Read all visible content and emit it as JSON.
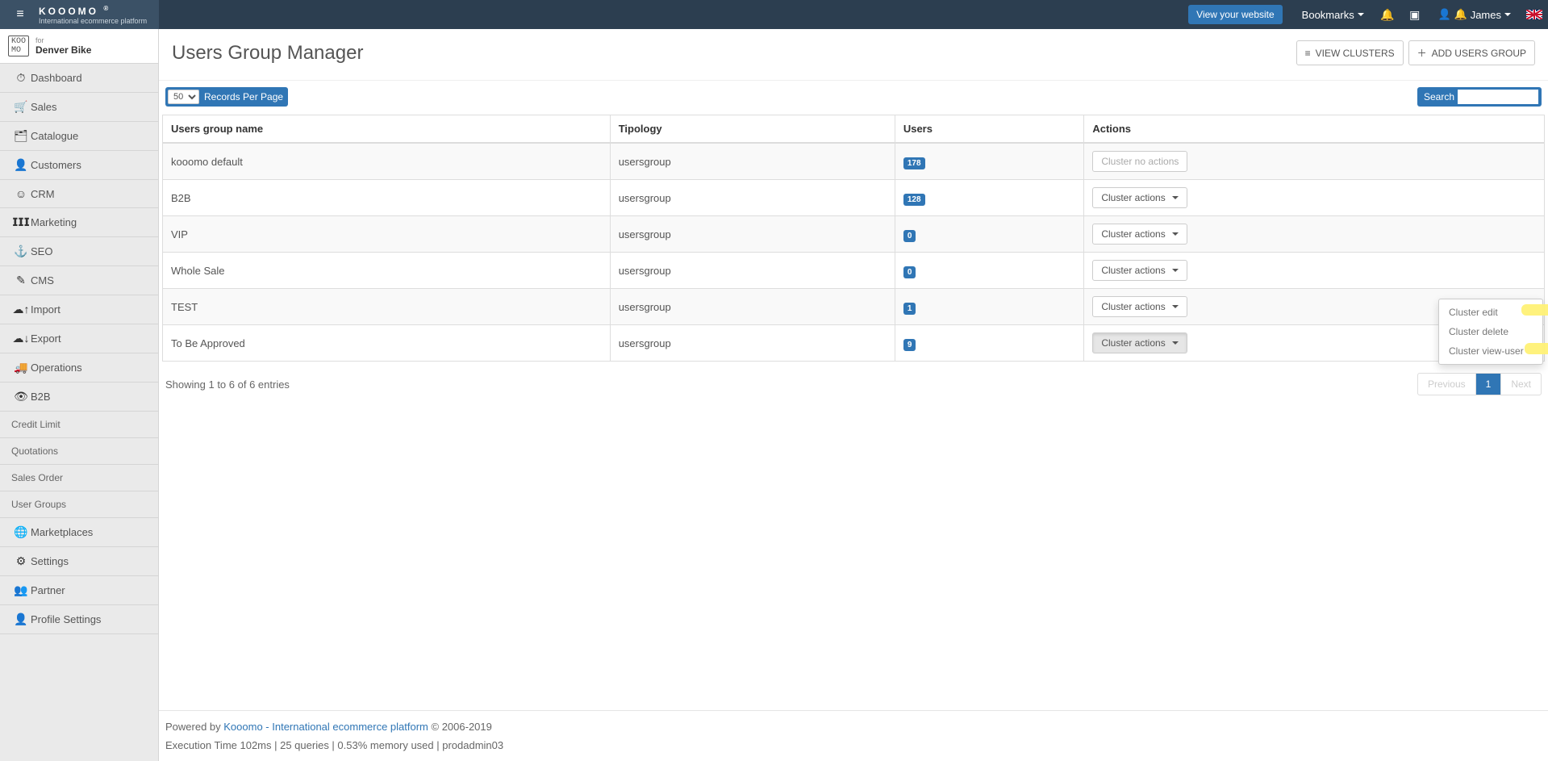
{
  "brand": {
    "title": "KOOOMO",
    "reg": "®",
    "sub": "International ecommerce platform"
  },
  "top": {
    "view_website": "View your website",
    "bookmarks": "Bookmarks",
    "user": "James"
  },
  "store": {
    "for": "for",
    "name": "Denver Bike"
  },
  "sidebar": {
    "items": [
      {
        "label": "Dashboard",
        "icon": "dash"
      },
      {
        "label": "Sales",
        "icon": "cart"
      },
      {
        "label": "Catalogue",
        "icon": "folder"
      },
      {
        "label": "Customers",
        "icon": "user"
      },
      {
        "label": "CRM",
        "icon": "smile"
      },
      {
        "label": "Marketing",
        "icon": "chart"
      },
      {
        "label": "SEO",
        "icon": "anchor"
      },
      {
        "label": "CMS",
        "icon": "edit"
      },
      {
        "label": "Import",
        "icon": "cloud-up"
      },
      {
        "label": "Export",
        "icon": "cloud-down"
      },
      {
        "label": "Operations",
        "icon": "truck"
      },
      {
        "label": "B2B",
        "icon": "eye"
      }
    ],
    "subitems": [
      {
        "label": "Credit Limit"
      },
      {
        "label": "Quotations"
      },
      {
        "label": "Sales Order"
      },
      {
        "label": "User Groups"
      }
    ],
    "items2": [
      {
        "label": "Marketplaces",
        "icon": "globe"
      },
      {
        "label": "Settings",
        "icon": "gear"
      },
      {
        "label": "Partner",
        "icon": "users"
      },
      {
        "label": "Profile Settings",
        "icon": "user"
      }
    ]
  },
  "page": {
    "title": "Users Group Manager",
    "view_clusters": "VIEW CLUSTERS",
    "add_group": "ADD USERS GROUP"
  },
  "toolbar": {
    "records_label": "Records Per Page",
    "records_value": "50",
    "search_label": "Search"
  },
  "table": {
    "headers": [
      "Users group name",
      "Tipology",
      "Users",
      "Actions"
    ],
    "rows": [
      {
        "name": "kooomo default",
        "tipology": "usersgroup",
        "users": "178",
        "action": "Cluster no actions",
        "disabled": true
      },
      {
        "name": "B2B",
        "tipology": "usersgroup",
        "users": "128",
        "action": "Cluster actions"
      },
      {
        "name": "VIP",
        "tipology": "usersgroup",
        "users": "0",
        "action": "Cluster actions"
      },
      {
        "name": "Whole Sale",
        "tipology": "usersgroup",
        "users": "0",
        "action": "Cluster actions"
      },
      {
        "name": "TEST",
        "tipology": "usersgroup",
        "users": "1",
        "action": "Cluster actions"
      },
      {
        "name": "To Be Approved",
        "tipology": "usersgroup",
        "users": "9",
        "action": "Cluster actions",
        "open": true
      }
    ]
  },
  "dropdown": {
    "items": [
      "Cluster edit",
      "Cluster delete",
      "Cluster view-user"
    ]
  },
  "entries_text": "Showing 1 to 6 of 6 entries",
  "pager": {
    "prev": "Previous",
    "page": "1",
    "next": "Next"
  },
  "footer": {
    "powered": "Powered by ",
    "link": "Kooomo - International ecommerce platform",
    "copy": " © 2006-2019",
    "exec": "Execution Time 102ms | 25 queries | 0.53% memory used | prodadmin03"
  },
  "icons": {
    "dash": "◉",
    "cart": "🛒",
    "folder": "▣",
    "user": "👤",
    "smile": "☺",
    "chart": "📊",
    "anchor": "⚓",
    "edit": "✎",
    "cloud-up": "☁",
    "cloud-down": "☁",
    "truck": "🚚",
    "eye": "👁",
    "globe": "🌐",
    "gear": "⚙",
    "users": "👥",
    "list": "≡",
    "plus": "+"
  }
}
